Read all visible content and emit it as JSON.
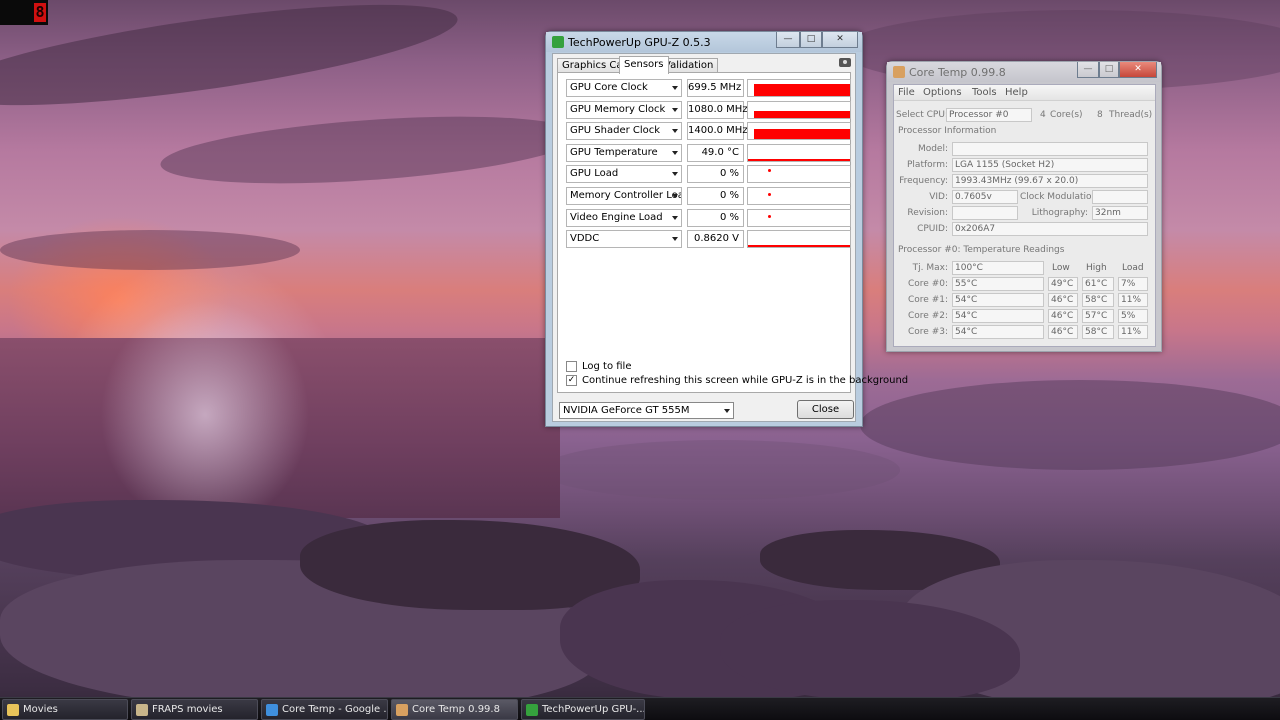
{
  "fraps": {
    "fps": "8"
  },
  "gpuz": {
    "title": "TechPowerUp GPU-Z 0.5.3",
    "tabs": [
      {
        "label": "Graphics Card"
      },
      {
        "label": "Sensors"
      },
      {
        "label": "Validation"
      }
    ],
    "active_tab": "Sensors",
    "sensors": [
      {
        "name": "GPU Core Clock",
        "value": "699.5 MHz",
        "level": 1.0
      },
      {
        "name": "GPU Memory Clock",
        "value": "1080.0 MHz",
        "level": 0.55
      },
      {
        "name": "GPU Shader Clock",
        "value": "1400.0 MHz",
        "level": 0.8
      },
      {
        "name": "GPU Temperature",
        "value": "49.0 °C",
        "level": 0.15
      },
      {
        "name": "GPU Load",
        "value": "0 %",
        "level": 0
      },
      {
        "name": "Memory Controller Load",
        "value": "0 %",
        "level": 0
      },
      {
        "name": "Video Engine Load",
        "value": "0 %",
        "level": 0
      },
      {
        "name": "VDDC",
        "value": "0.8620 V",
        "level": 0.2
      }
    ],
    "log_to_file": {
      "label": "Log to file",
      "checked": false
    },
    "continue_refresh": {
      "label": "Continue refreshing this screen while GPU-Z is in the background",
      "checked": true
    },
    "gpu_select": "NVIDIA GeForce GT 555M",
    "close_label": "Close",
    "graph_color": "#ff0000"
  },
  "coretemp": {
    "title": "Core Temp 0.99.8",
    "menu": [
      "File",
      "Options",
      "Tools",
      "Help"
    ],
    "select_cpu_label": "Select CPU:",
    "select_cpu_value": "Processor #0",
    "cores_count": "4",
    "cores_label": "Core(s)",
    "threads_count": "8",
    "threads_label": "Thread(s)",
    "proc_info_header": "Processor Information",
    "model_label": "Model:",
    "model_value": "",
    "platform_label": "Platform:",
    "platform_value": "LGA 1155 (Socket H2)",
    "frequency_label": "Frequency:",
    "frequency_value": "1993.43MHz (99.67 x 20.0)",
    "vid_label": "VID:",
    "vid_value": "0.7605v",
    "clock_mod_label": "Clock Modulation:",
    "clock_mod_value": "",
    "revision_label": "Revision:",
    "revision_value": "",
    "lithography_label": "Lithography:",
    "lithography_value": "32nm",
    "cpuid_label": "CPUID:",
    "cpuid_value": "0x206A7",
    "temp_header": "Processor #0: Temperature Readings",
    "tjmax_label": "Tj. Max:",
    "tjmax_value": "100°C",
    "col_low": "Low",
    "col_high": "High",
    "col_load": "Load",
    "cores": [
      {
        "label": "Core #0:",
        "temp": "55°C",
        "low": "49°C",
        "high": "61°C",
        "load": "7%"
      },
      {
        "label": "Core #1:",
        "temp": "54°C",
        "low": "46°C",
        "high": "58°C",
        "load": "11%"
      },
      {
        "label": "Core #2:",
        "temp": "54°C",
        "low": "46°C",
        "high": "57°C",
        "load": "5%"
      },
      {
        "label": "Core #3:",
        "temp": "54°C",
        "low": "46°C",
        "high": "58°C",
        "load": "11%"
      }
    ]
  },
  "taskbar": {
    "items": [
      {
        "label": "Movies",
        "icon": "folder-icon",
        "active": false
      },
      {
        "label": "FRAPS movies",
        "icon": "fraps-icon",
        "active": false
      },
      {
        "label": "Core Temp - Google ...",
        "icon": "chrome-icon",
        "active": false
      },
      {
        "label": "Core Temp 0.99.8",
        "icon": "coretemp-icon",
        "active": true
      },
      {
        "label": "TechPowerUp GPU-...",
        "icon": "gpuz-icon",
        "active": false
      }
    ]
  }
}
